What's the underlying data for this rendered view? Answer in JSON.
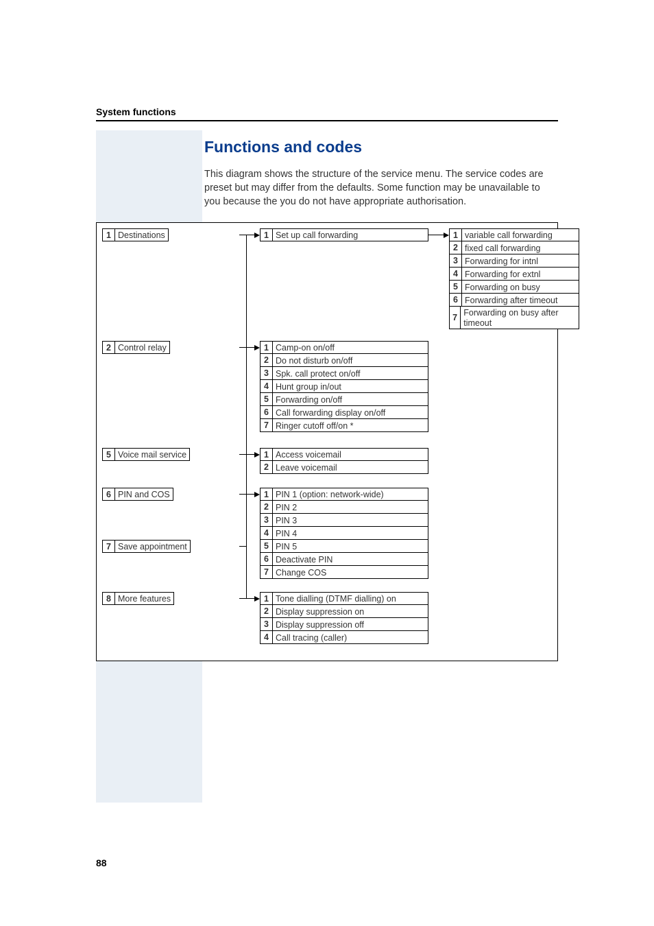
{
  "sectionHeader": "System functions",
  "title": "Functions and codes",
  "intro": "This diagram shows the structure of the service menu. The service codes are preset but may differ from the defaults. Some function may be unavailable to you because the you do not have appropriate authorisation.",
  "col1": {
    "b1": {
      "n": "1",
      "l": "Destinations"
    },
    "b2": {
      "n": "2",
      "l": "Control relay"
    },
    "b5": {
      "n": "5",
      "l": "Voice mail service"
    },
    "b6": {
      "n": "6",
      "l": "PIN and COS"
    },
    "b7": {
      "n": "7",
      "l": "Save appointment"
    },
    "b8": {
      "n": "8",
      "l": "More features"
    }
  },
  "col2": {
    "g1": {
      "n": "1",
      "l": "Set up call forwarding"
    },
    "g2": [
      {
        "n": "1",
        "l": "Camp-on on/off"
      },
      {
        "n": "2",
        "l": "Do not disturb on/off"
      },
      {
        "n": "3",
        "l": "Spk. call protect on/off"
      },
      {
        "n": "4",
        "l": "Hunt group in/out"
      },
      {
        "n": "5",
        "l": "Forwarding on/off"
      },
      {
        "n": "6",
        "l": "Call forwarding display on/off"
      },
      {
        "n": "7",
        "l": "Ringer cutoff off/on *"
      }
    ],
    "g5": [
      {
        "n": "1",
        "l": "Access voicemail"
      },
      {
        "n": "2",
        "l": "Leave voicemail"
      }
    ],
    "g6": [
      {
        "n": "1",
        "l": "PIN 1 (option: network-wide)"
      },
      {
        "n": "2",
        "l": "PIN 2"
      },
      {
        "n": "3",
        "l": "PIN 3"
      },
      {
        "n": "4",
        "l": "PIN 4"
      },
      {
        "n": "5",
        "l": "PIN 5"
      },
      {
        "n": "6",
        "l": "Deactivate PIN"
      },
      {
        "n": "7",
        "l": "Change COS"
      }
    ],
    "g8": [
      {
        "n": "1",
        "l": "Tone dialling (DTMF dialling) on"
      },
      {
        "n": "2",
        "l": "Display suppression on"
      },
      {
        "n": "3",
        "l": "Display suppression off"
      },
      {
        "n": "4",
        "l": "Call tracing (caller)"
      }
    ]
  },
  "col3": [
    {
      "n": "1",
      "l": "variable call forwarding"
    },
    {
      "n": "2",
      "l": "fixed call forwarding"
    },
    {
      "n": "3",
      "l": "Forwarding for intnl"
    },
    {
      "n": "4",
      "l": "Forwarding for extnl"
    },
    {
      "n": "5",
      "l": "Forwarding on busy"
    },
    {
      "n": "6",
      "l": "Forwarding after timeout"
    },
    {
      "n": "7",
      "l": "Forwarding on busy after timeout"
    }
  ],
  "pageNum": "88"
}
